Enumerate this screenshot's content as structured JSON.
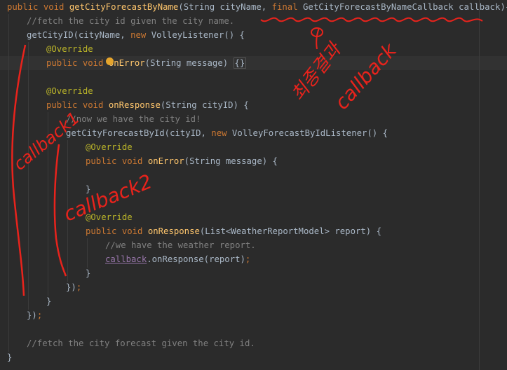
{
  "code": {
    "l1": {
      "kw1": "public void ",
      "fn": "getCityForecastByName",
      "p1": "(String cityName, ",
      "kw2": "final ",
      "p2": "GetCityForecastByNameCallback callback){"
    },
    "l2": {
      "cm": "//fetch the city id given the city name."
    },
    "l3": {
      "t1": "getCityID(cityName, ",
      "kw": "new ",
      "t2": "VolleyListener() {"
    },
    "l4": {
      "an": "@Override"
    },
    "l5": {
      "kw": "public void ",
      "fn": "onError",
      "t": "(String message) ",
      "br": "{}"
    },
    "l7": {
      "an": "@Override"
    },
    "l8": {
      "kw": "public void ",
      "fn": "onResponse",
      "t": "(String cityID) {"
    },
    "l9": {
      "cm": "//now we have the city id!"
    },
    "l10": {
      "t1": "getCityForecastById(cityID, ",
      "kw": "new ",
      "t2": "VolleyForecastByIdListener() {"
    },
    "l11": {
      "an": "@Override"
    },
    "l12": {
      "kw": "public void ",
      "fn": "onError",
      "t": "(String message) {"
    },
    "l14": {
      "t": "}"
    },
    "l16": {
      "an": "@Override"
    },
    "l17": {
      "kw": "public void ",
      "fn": "onResponse",
      "t": "(List<WeatherReportModel> report) {"
    },
    "l18": {
      "cm": "//we have the weather report."
    },
    "l19": {
      "fld": "callback",
      "t": ".onResponse(report)",
      "semi": ";"
    },
    "l20": {
      "t": "}"
    },
    "l21": {
      "t1": "})",
      "semi": ";"
    },
    "l22": {
      "t": "}"
    },
    "l23": {
      "t1": "})",
      "semi": ";"
    },
    "l25": {
      "cm": "//fetch the city forecast given the city id."
    },
    "l26": {
      "t": "}"
    }
  },
  "annotations": {
    "callback1": "callback1",
    "callback2": "callback2",
    "final_korean": "최종결과",
    "final_callback": "callback"
  },
  "colors": {
    "background": "#2b2b2b",
    "keyword": "#cc7832",
    "function": "#ffc66d",
    "comment": "#808080",
    "annotation": "#bbb529",
    "field": "#9876aa",
    "ink": "#e8231c"
  }
}
